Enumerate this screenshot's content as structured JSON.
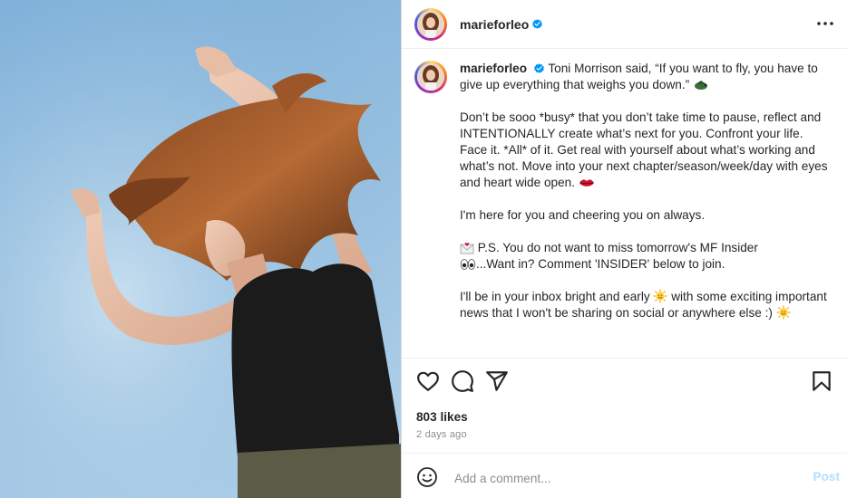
{
  "post": {
    "username": "marieforleo",
    "caption": {
      "lead": "Toni Morrison said, “If you want to fly, you have to give up everything that weighs you down.”",
      "paragraph_2": "Don’t be sooo *busy* that you don’t take time to pause, reflect and INTENTIONALLY create what’s next for you. Confront your life. Face it. *All* of it. Get real with yourself about what’s working and what’s not. Move into your next chapter/season/week/day with eyes and heart wide open.",
      "paragraph_3": "I'm here for you and cheering you on always.",
      "paragraph_4a": "P.S. You do not want to miss tomorrow's MF Insider",
      "paragraph_4b": "...Want in? Comment 'INSIDER' below to join.",
      "paragraph_5a": "I'll be in your inbox bright and early",
      "paragraph_5b": "with some exciting important news that I won't be sharing on social or anywhere else :)"
    },
    "likes": "803 likes",
    "date": "2 days ago",
    "comment": {
      "placeholder": "Add a comment...",
      "post_label": "Post"
    }
  },
  "icons": {
    "verified": "verified-badge-icon",
    "more": "more-options-icon",
    "like": "heart-icon",
    "comment": "comment-bubble-icon",
    "share": "share-paper-plane-icon",
    "save": "bookmark-icon",
    "emoji": "smiley-icon"
  },
  "colors": {
    "verified_blue": "#0095f6",
    "post_button_disabled": "#b2dffc",
    "secondary_text": "#8e8e8e"
  }
}
